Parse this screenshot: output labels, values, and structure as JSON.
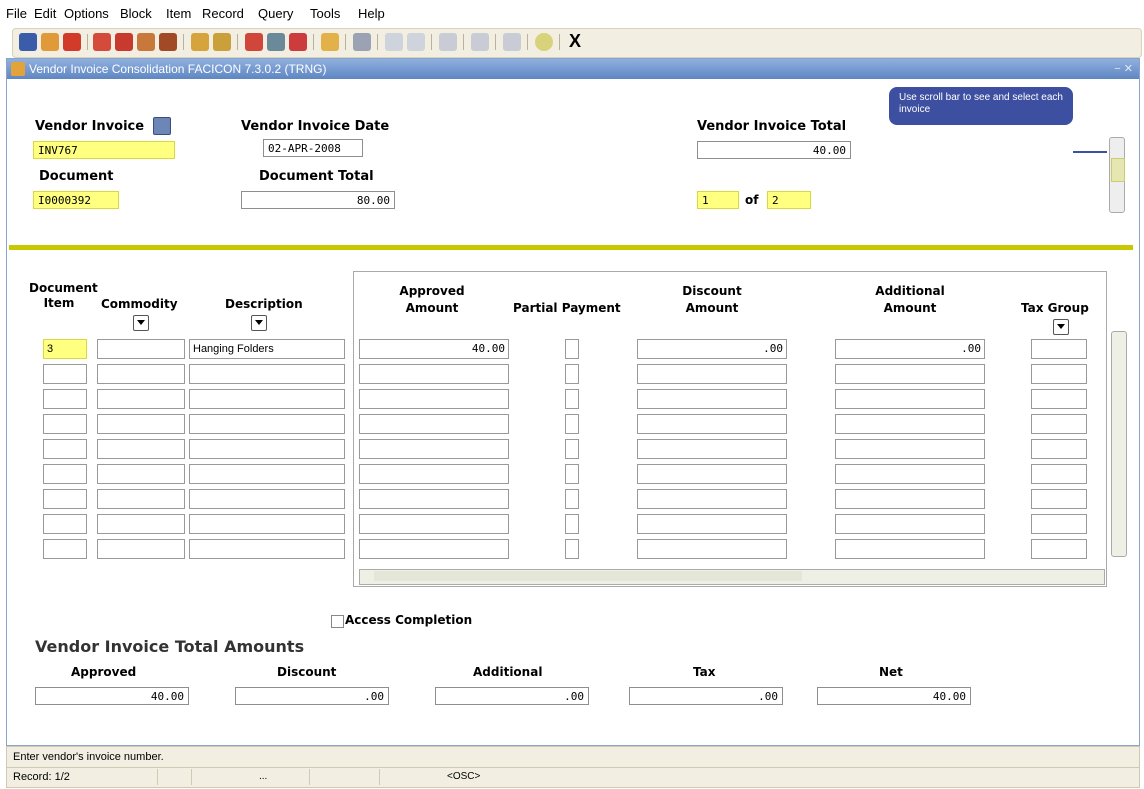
{
  "menu": [
    "File",
    "Edit",
    "Options",
    "Block",
    "Item",
    "Record",
    "Query",
    "Tools",
    "Help"
  ],
  "toolbar": {
    "exit_label": "X"
  },
  "window": {
    "title": "Vendor Invoice Consolidation  FACICON  7.3.0.2  (TRNG)",
    "controls": "− ✕"
  },
  "header": {
    "vendor_invoice_label": "Vendor Invoice",
    "vendor_invoice_value": "INV767",
    "vendor_invoice_date_label": "Vendor Invoice Date",
    "vendor_invoice_date_value": "02-APR-2008",
    "vendor_invoice_total_label": "Vendor Invoice Total",
    "vendor_invoice_total_value": "40.00",
    "document_label": "Document",
    "document_value": "I0000392",
    "document_total_label": "Document Total",
    "document_total_value": "80.00",
    "record_current": "1",
    "record_of_label": "of",
    "record_total": "2",
    "tooltip": "Use scroll bar to see and select each invoice"
  },
  "grid": {
    "headers": {
      "document_item": "Document Item",
      "commodity": "Commodity",
      "description": "Description",
      "approved_amount": "Approved Amount",
      "partial_payment": "Partial Payment",
      "discount_amount": "Discount Amount",
      "additional_amount": "Additional Amount",
      "tax_group": "Tax Group"
    },
    "rows": [
      {
        "item": "3",
        "commodity": "",
        "description": "Hanging Folders",
        "approved": "40.00",
        "discount": ".00",
        "additional": ".00"
      }
    ]
  },
  "access_completion_label": "Access Completion",
  "totals": {
    "title": "Vendor Invoice Total Amounts",
    "approved_label": "Approved",
    "approved_value": "40.00",
    "discount_label": "Discount",
    "discount_value": ".00",
    "additional_label": "Additional",
    "additional_value": ".00",
    "tax_label": "Tax",
    "tax_value": ".00",
    "net_label": "Net",
    "net_value": "40.00"
  },
  "status": {
    "message": "Enter vendor's invoice number.",
    "record": "Record: 1/2",
    "dots": "...",
    "mode": "<OSC>"
  }
}
